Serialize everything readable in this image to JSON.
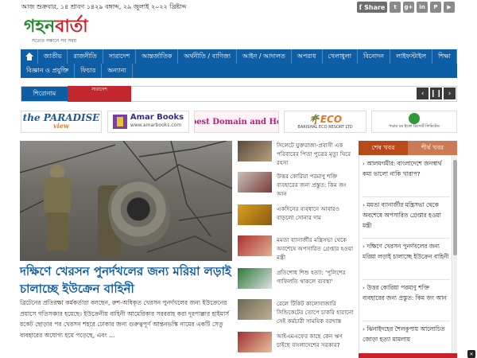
{
  "topbar": {
    "date": "আজ শুক্রবার, ১৪ শ্রাবণ ১৪২৯ বঙ্গাব্দ, ২৯ জুলাই ২০২২ খ্রিষ্টাব্দ",
    "share_label": "Share",
    "social_icons": [
      "facebook-icon",
      "twitter-icon",
      "google-plus-icon",
      "linkedin-icon",
      "pinterest-icon",
      "youtube-icon"
    ]
  },
  "logo": {
    "part1": "গহন",
    "part2": "বার্তা",
    "tagline": "সত্যের সন্ধানে সব সময়"
  },
  "nav": {
    "items": [
      "জাতীয়",
      "রাজনীতি",
      "সারাদেশ",
      "আন্তর্জাতিক",
      "অর্থনীতি / বাণিজ্য",
      "আইন / আদালত",
      "অপরাধ",
      "খেলাধুলা",
      "বিনোদন",
      "লাইফস্টাইল",
      "শিক্ষা",
      "বিজ্ঞান ও প্রযুক্তি",
      "ফিচার",
      "অন্যান্য"
    ]
  },
  "ticker": {
    "label": "শিরোনাম",
    "headline": "সারাদেশ",
    "controls": [
      "‹",
      "❙❙",
      "›"
    ]
  },
  "ads": {
    "ad1_title": "the PARADISE",
    "ad1_sub": "view",
    "ad2_title": "Amar Books",
    "ad2_sub": "www.amarbooks.com",
    "ad3_title": "Cheapest Domain and Hosting",
    "ad4_title": "ECO",
    "ad4_sub": "BARISHAL ECO RESORT LTD",
    "ad5_title": "পদ্মার চর ইকো রিসোর্ট লিমিটেড"
  },
  "lead": {
    "headline": "দক্ষিণে খেরসন পুনর্দখলের জন্য মরিয়া লড়াই চালাচ্ছে ইউক্রেন বাহিনী",
    "summary": "ব্রিটেনের প্রতিরক্ষা কর্মকর্তারা বলছেন, রুশ-অধিকৃত খেরসন পুনর্দখলের জন্য ইউক্রেনের প্রয়াসে গতিসঞ্চার হয়েছে। ইউক্রেনীয় বাহিনী আমেরিকার সরবরাহ করা দূরপাল্লার হাইমার্স রকেট ছোড়ার পর খেরসন শহরে ঢোকার জন্য গুরুত্বপূর্ণ আন্তনভস্কি নামের একটি সেতু ব্যবহারের অযোগ্য হয়ে পড়েছে, এবং ..."
  },
  "mid_news": [
    {
      "title": "সিলেটে যুক্তরাজ্য-প্রবাসী এক পরিবারের পিতা পুত্রের মৃত্যু ঘিরে রহস্য"
    },
    {
      "title": "উত্তর কোরিয়া পরমাণু শক্তি ব্যবহারের জন্য প্রস্তুত: কিম জং আন"
    },
    {
      "title": "একদিনের ব্যবধানে আবারও বাড়লো সোনার দাম"
    },
    {
      "title": "মমতা ব্যানার্জীর মন্ত্রিসভা থেকে অবশেষে অপসারিত গ্রেপ্তার হওয়া মন্ত্রী"
    },
    {
      "title": "প্রতিশোধ শিশু হত্যা: 'পুলিশের গাফিলতি থাকলে ব্যবস্থা'"
    },
    {
      "title": "রেলে টিকিট কালোবাজারি সিন্ডিকেটের তোপে চাকরি হারানো সেই কর্মচারী সাময়িক বরখাস্ত"
    },
    {
      "title": "আইএমএফের কাছে কেন ঋণ চাইছে বাংলাদেশের সরকার?"
    }
  ],
  "right_panel": {
    "tab_latest": "শেষ খবর",
    "tab_top": "শীর্ষ খবর",
    "items": [
      "আলমগমীর: বাংলাদেশে জনস্বার্থ কমা ভালো নাকি খারাপ?",
      "মমতা ব্যানার্জীর মন্ত্রিসভা থেকে অবশেষে অপসারিত গ্রেপ্তার হওয়া মন্ত্রী",
      "দক্ষিণে খেরসন পুনর্দখলের জন্য মরিয়া লড়াই চালাচ্ছে ইউক্রেন বাহিনী",
      "উত্তর কোরিয়া পরমাণু শক্তি ব্যবহারের জন্য প্রস্তুত: কিম জং আন",
      "ঝিনাইদহের শৈলকুপায় আলোচিত জোড়া হত্যা মামলায়"
    ]
  }
}
